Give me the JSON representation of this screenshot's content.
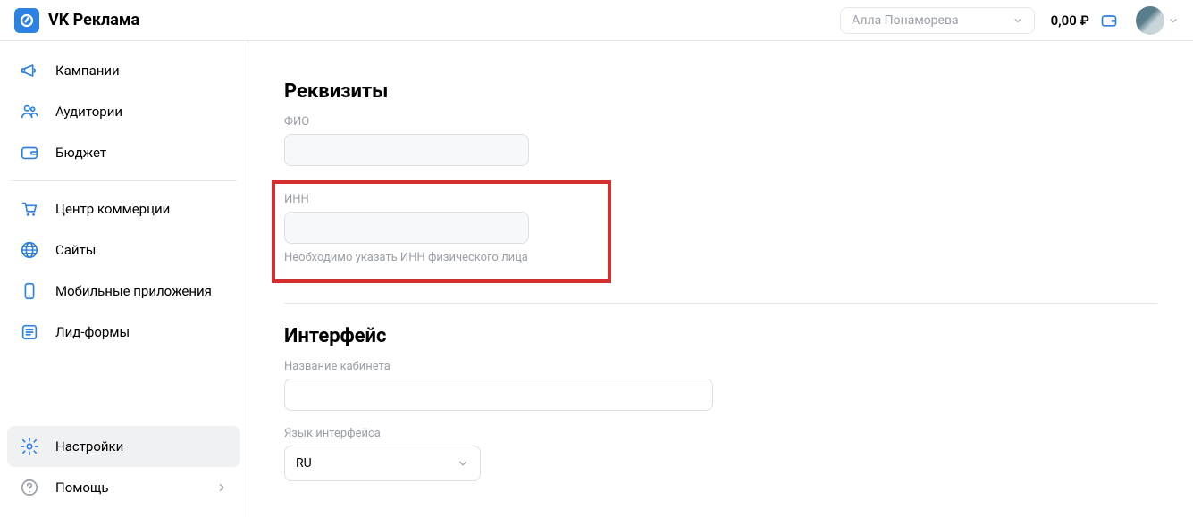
{
  "header": {
    "app_name": "VK Реклама",
    "account_name": "Алла Понаморева",
    "balance": "0,00 ₽"
  },
  "sidebar": {
    "items": [
      {
        "label": "Кампании"
      },
      {
        "label": "Аудитории"
      },
      {
        "label": "Бюджет"
      },
      {
        "label": "Центр коммерции"
      },
      {
        "label": "Сайты"
      },
      {
        "label": "Мобильные приложения"
      },
      {
        "label": "Лид-формы"
      }
    ],
    "bottom": {
      "settings": "Настройки",
      "help": "Помощь"
    }
  },
  "main": {
    "section1_title": "Реквизиты",
    "fio_label": "ФИО",
    "fio_value": "",
    "inn_label": "ИНН",
    "inn_value": "",
    "inn_help": "Необходимо указать ИНН физического лица",
    "section2_title": "Интерфейс",
    "cabinet_label": "Название кабинета",
    "cabinet_value": "",
    "lang_label": "Язык интерфейса",
    "lang_value": "RU"
  }
}
